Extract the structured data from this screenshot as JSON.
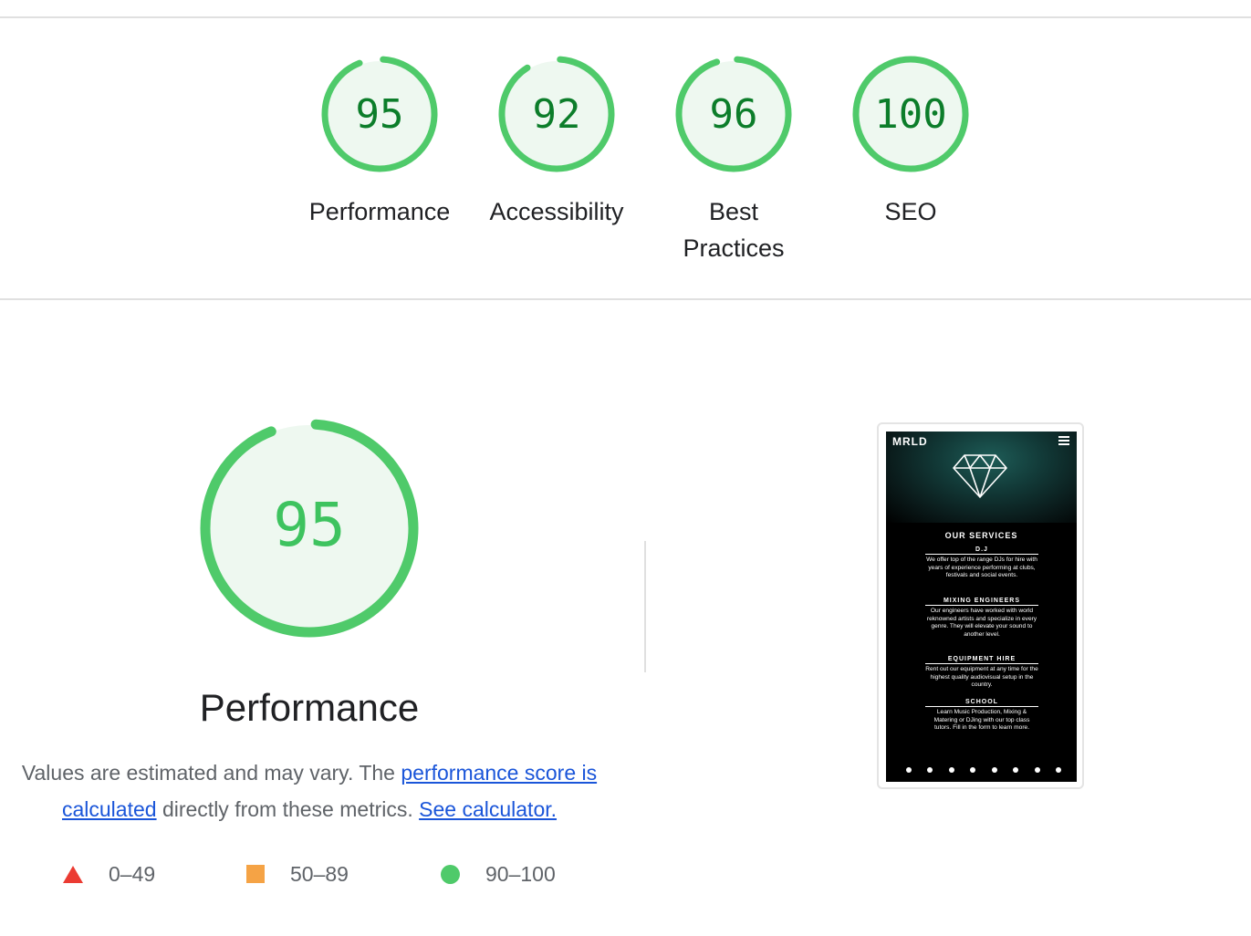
{
  "summary": {
    "gauges": [
      {
        "score": "95",
        "label": "Performance",
        "fraction": 0.95
      },
      {
        "score": "92",
        "label": "Accessibility",
        "fraction": 0.92
      },
      {
        "score": "96",
        "label_line1": "Best",
        "label_line2": "Practices",
        "fraction": 0.96
      },
      {
        "score": "100",
        "label": "SEO",
        "fraction": 1.0
      }
    ]
  },
  "performance": {
    "score": "95",
    "fraction": 0.95,
    "title": "Performance",
    "desc_prefix": "Values are estimated and may vary. The ",
    "desc_link1": "performance score is calculated",
    "desc_middle": " directly from these metrics. ",
    "desc_link2": "See calculator.",
    "legend": [
      {
        "range": "0–49",
        "icon": "triangle-icon",
        "color": "#eb3b32"
      },
      {
        "range": "50–89",
        "icon": "square-icon",
        "color": "#f5a345"
      },
      {
        "range": "90–100",
        "icon": "circle-icon",
        "color": "#4fca6a"
      }
    ]
  },
  "screenshot": {
    "brand": "MRLD",
    "services_title": "OUR SERVICES",
    "services": [
      {
        "heading": "D.J",
        "body": "We offer top of the range DJs for hire with years of experience performing at clubs, festivals and social events."
      },
      {
        "heading": "MIXING ENGINEERS",
        "body": "Our engineers have worked with world reknowned artists and specialize in every genre. They will elevate your sound to another level."
      },
      {
        "heading": "EQUIPMENT HIRE",
        "body": "Rent out our equipment at any time for the highest quality audiovisual setup in the country."
      },
      {
        "heading": "SCHOOL",
        "body": "Learn Music Production, Mixing & Matering or DJing with our top class tutors. Fill in the form to learn more."
      }
    ]
  },
  "colors": {
    "pass": "#0c7d2a",
    "pass_ring": "#4fca6a",
    "pass_fill": "#eef8f0",
    "link": "#1a55d9"
  }
}
